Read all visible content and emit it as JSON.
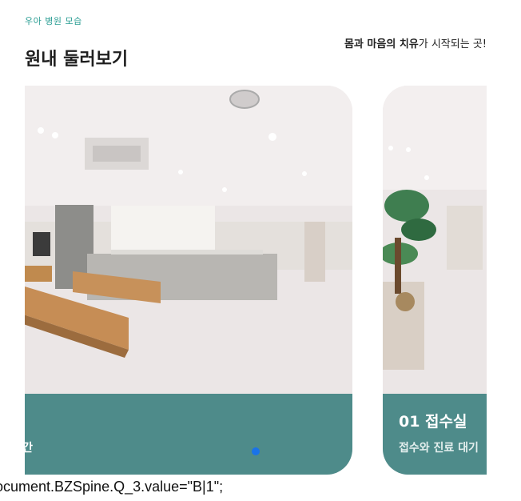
{
  "section": {
    "eyebrow": "우아 병원 모습",
    "title": "원내 둘러보기",
    "tagline_bold1": "몸과 마음의 치유",
    "tagline_rest": "가 시작되는 곳!"
  },
  "slides": [
    {
      "title": "",
      "desc": "간",
      "image": "hospital-lobby-photo"
    },
    {
      "title": "01 접수실",
      "desc": "접수와 진료 대기",
      "image": "reception-plant-photo"
    }
  ],
  "pagination": {
    "active_color": "#1a73e8"
  },
  "colors": {
    "accent": "#2a9d93",
    "caption_bg": "#4e8b8a"
  },
  "footer_code": "ocument.BZSpine.Q_3.value=\"B|1\";"
}
